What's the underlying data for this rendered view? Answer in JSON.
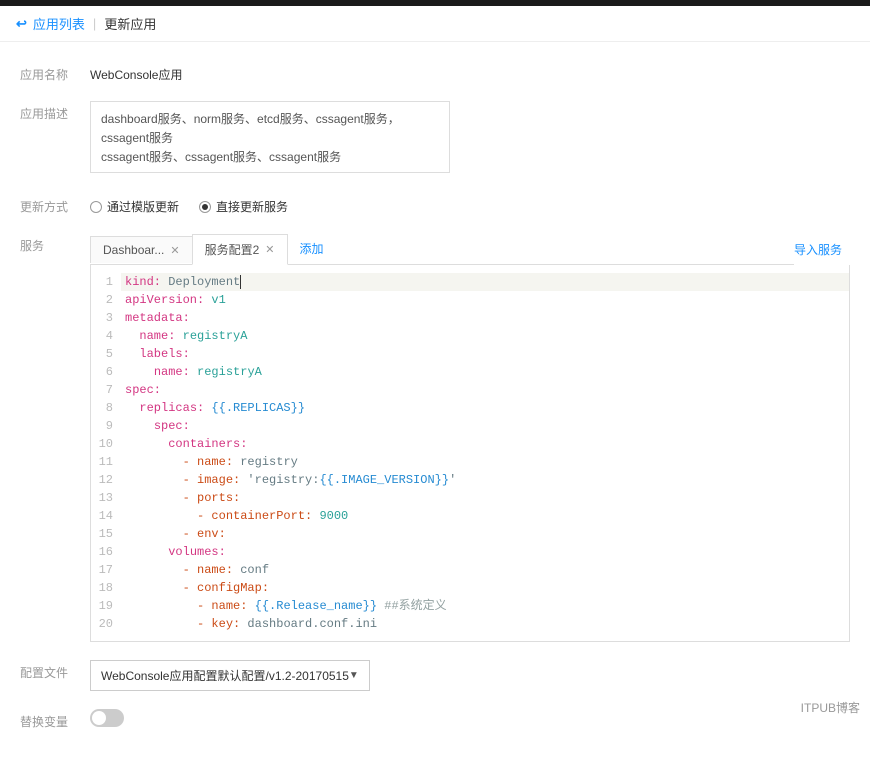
{
  "breadcrumb": {
    "back": "应用列表",
    "current": "更新应用"
  },
  "form": {
    "name_label": "应用名称",
    "name_value": "WebConsole应用",
    "desc_label": "应用描述",
    "desc_value": "dashboard服务、norm服务、etcd服务、cssagent服务，cssagent服务\ncssagent服务、cssagent服务、cssagent服务",
    "update_label": "更新方式",
    "radio1": "通过模版更新",
    "radio2": "直接更新服务",
    "service_label": "服务",
    "config_label": "配置文件",
    "config_value": "WebConsole应用配置默认配置/v1.2-20170515",
    "var_label": "替换变量"
  },
  "tabs": {
    "tab1": "Dashboar...",
    "tab2": "服务配置2",
    "add": "添加",
    "import": "导入服务"
  },
  "code": {
    "lines": [
      {
        "n": 1,
        "hl": true,
        "segs": [
          [
            "k-key",
            "kind:"
          ],
          [
            "",
            " Deployment"
          ],
          [
            "cursor",
            ""
          ]
        ]
      },
      {
        "n": 2,
        "segs": [
          [
            "k-key",
            "apiVersion:"
          ],
          [
            "",
            " "
          ],
          [
            "k-teal",
            "v1"
          ]
        ]
      },
      {
        "n": 3,
        "segs": [
          [
            "k-key",
            "metadata:"
          ]
        ]
      },
      {
        "n": 4,
        "segs": [
          [
            "",
            "  "
          ],
          [
            "k-key",
            "name:"
          ],
          [
            "",
            " "
          ],
          [
            "k-teal",
            "registryA"
          ]
        ]
      },
      {
        "n": 5,
        "segs": [
          [
            "",
            "  "
          ],
          [
            "k-key",
            "labels:"
          ]
        ]
      },
      {
        "n": 6,
        "segs": [
          [
            "",
            "    "
          ],
          [
            "k-key",
            "name:"
          ],
          [
            "",
            " "
          ],
          [
            "k-teal",
            "registryA"
          ]
        ]
      },
      {
        "n": 7,
        "segs": [
          [
            "k-key",
            "spec:"
          ]
        ]
      },
      {
        "n": 8,
        "segs": [
          [
            "",
            "  "
          ],
          [
            "k-key",
            "replicas:"
          ],
          [
            "",
            " "
          ],
          [
            "k-blue",
            "{{.REPLICAS}}"
          ]
        ]
      },
      {
        "n": 9,
        "segs": [
          [
            "",
            "    "
          ],
          [
            "k-key",
            "spec:"
          ]
        ]
      },
      {
        "n": 10,
        "segs": [
          [
            "",
            "      "
          ],
          [
            "k-key",
            "containers:"
          ]
        ]
      },
      {
        "n": 11,
        "segs": [
          [
            "",
            "        "
          ],
          [
            "k-orange",
            "- name:"
          ],
          [
            "",
            " registry"
          ]
        ]
      },
      {
        "n": 12,
        "segs": [
          [
            "",
            "        "
          ],
          [
            "k-orange",
            "- image:"
          ],
          [
            "",
            " 'registry:"
          ],
          [
            "k-blue",
            "{{.IMAGE_VERSION}}"
          ],
          [
            "",
            "'"
          ]
        ]
      },
      {
        "n": 13,
        "segs": [
          [
            "",
            "        "
          ],
          [
            "k-orange",
            "- ports:"
          ]
        ]
      },
      {
        "n": 14,
        "segs": [
          [
            "",
            "          "
          ],
          [
            "k-orange",
            "- containerPort:"
          ],
          [
            "",
            " "
          ],
          [
            "k-teal",
            "9000"
          ]
        ]
      },
      {
        "n": 15,
        "segs": [
          [
            "",
            "        "
          ],
          [
            "k-orange",
            "- env:"
          ]
        ]
      },
      {
        "n": 16,
        "segs": [
          [
            "",
            "      "
          ],
          [
            "k-key",
            "volumes:"
          ]
        ]
      },
      {
        "n": 17,
        "segs": [
          [
            "",
            "        "
          ],
          [
            "k-orange",
            "- name:"
          ],
          [
            "",
            " conf"
          ]
        ]
      },
      {
        "n": 18,
        "segs": [
          [
            "",
            "        "
          ],
          [
            "k-orange",
            "- configMap:"
          ]
        ]
      },
      {
        "n": 19,
        "segs": [
          [
            "",
            "          "
          ],
          [
            "k-orange",
            "- name:"
          ],
          [
            "",
            " "
          ],
          [
            "k-blue",
            "{{.Release_name}}"
          ],
          [
            "",
            " "
          ],
          [
            "k-gray",
            "##系统定义"
          ]
        ]
      },
      {
        "n": 20,
        "segs": [
          [
            "",
            "          "
          ],
          [
            "k-orange",
            "- key:"
          ],
          [
            "",
            " dashboard.conf.ini"
          ]
        ]
      }
    ]
  },
  "watermark": "ITPUB博客"
}
